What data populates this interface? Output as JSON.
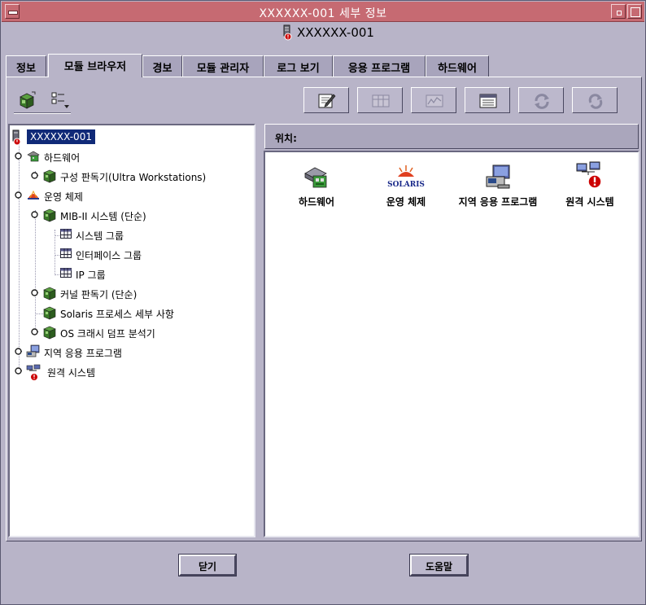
{
  "window": {
    "title": "XXXXXX-001 세부 정보",
    "host_name": "XXXXXX-001"
  },
  "tabs": [
    {
      "label": "정보"
    },
    {
      "label": "모듈 브라우저"
    },
    {
      "label": "경보"
    },
    {
      "label": "모듈 관리자"
    },
    {
      "label": "로그 보기"
    },
    {
      "label": "응용 프로그램"
    },
    {
      "label": "하드웨어"
    }
  ],
  "active_tab": "모듈 브라우저",
  "toolbar": {
    "left_icons": [
      "tree-view-icon",
      "list-view-icon"
    ],
    "buttons": [
      {
        "icon": "edit-icon",
        "enabled": true
      },
      {
        "icon": "table-icon",
        "enabled": false
      },
      {
        "icon": "graph-icon",
        "enabled": false
      },
      {
        "icon": "detail-window-icon",
        "enabled": true
      },
      {
        "icon": "refresh-icon",
        "enabled": false
      },
      {
        "icon": "reload-icon",
        "enabled": false
      }
    ]
  },
  "tree": {
    "root": "XXXXXX-001",
    "nodes": [
      {
        "label": "하드웨어",
        "icon": "hardware-icon"
      },
      {
        "label": "구성 판독기(Ultra Workstations)",
        "icon": "module-icon"
      },
      {
        "label": "운영 체제",
        "icon": "solaris-icon"
      },
      {
        "label": "MIB-II 시스템 (단순)",
        "icon": "module-icon"
      },
      {
        "label": "시스템 그룹",
        "icon": "table-icon"
      },
      {
        "label": "인터페이스 그룹",
        "icon": "table-icon"
      },
      {
        "label": "IP 그룹",
        "icon": "table-icon"
      },
      {
        "label": "커널 판독기 (단순)",
        "icon": "module-icon"
      },
      {
        "label": "Solaris 프로세스 세부 사항",
        "icon": "module-icon"
      },
      {
        "label": "OS 크래시 덤프 분석기",
        "icon": "module-icon"
      },
      {
        "label": "지역 응용 프로그램",
        "icon": "local-apps-icon"
      },
      {
        "label": "원격 시스템",
        "icon": "remote-systems-icon"
      }
    ]
  },
  "location": {
    "label": "위치:"
  },
  "view_items": [
    {
      "label": "하드웨어",
      "icon": "hardware-icon"
    },
    {
      "label": "운영 체제",
      "icon": "solaris-icon",
      "logo_text": "SOLARIS"
    },
    {
      "label": "지역 응용 프로그램",
      "icon": "local-apps-icon"
    },
    {
      "label": "원격 시스템",
      "icon": "remote-systems-icon"
    }
  ],
  "footer": {
    "close_label": "닫기",
    "help_label": "도움말"
  },
  "colors": {
    "titlebar": "#c66a72",
    "background": "#b8b4c8",
    "selection": "#102a78",
    "alert": "#cc0000"
  }
}
